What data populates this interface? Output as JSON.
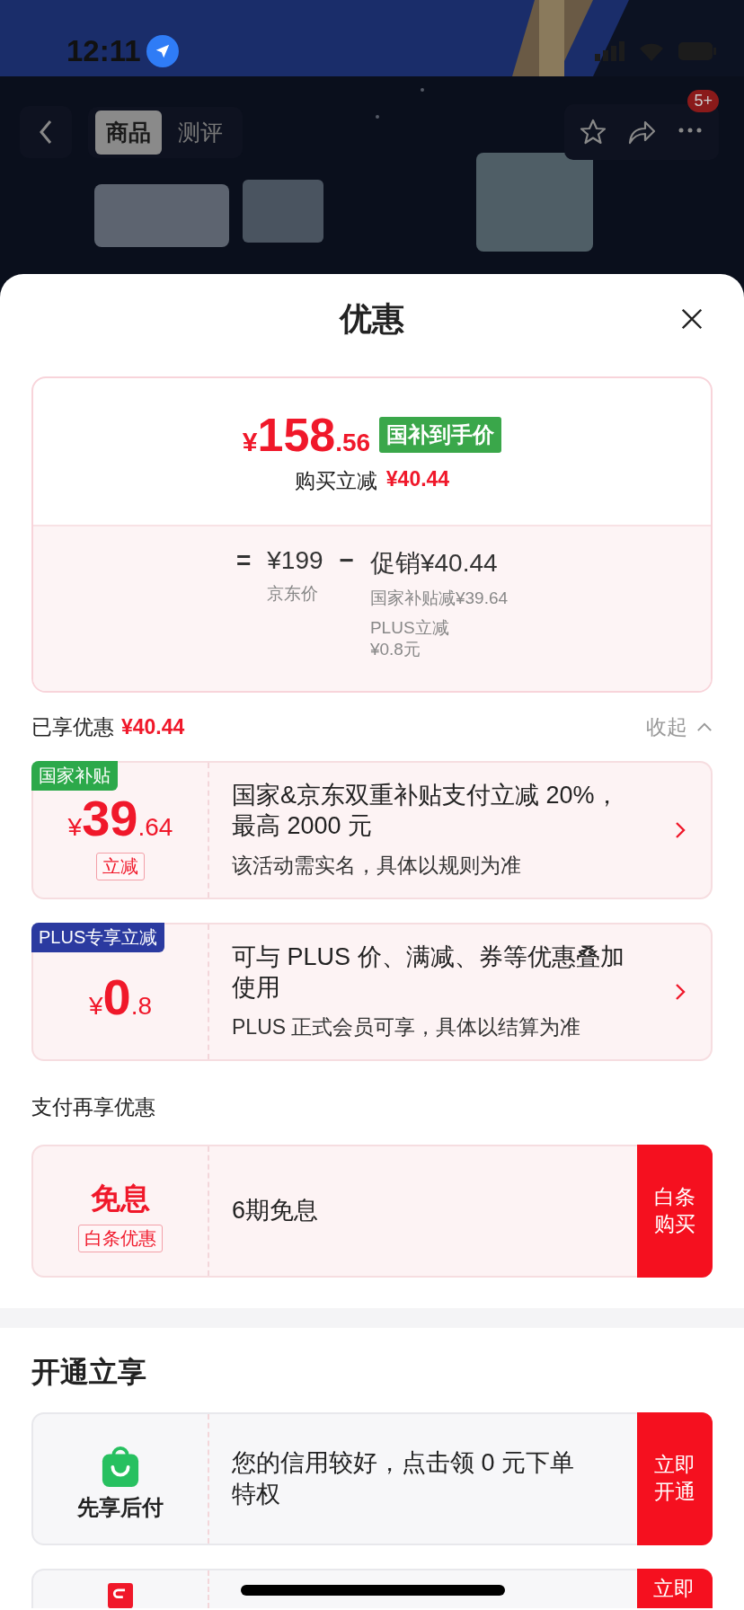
{
  "status_bar": {
    "time": "12:11"
  },
  "nav": {
    "tabs": [
      {
        "label": "商品",
        "selected": true
      },
      {
        "label": "测评",
        "selected": false
      }
    ],
    "more_badge": "5+"
  },
  "sheet": {
    "title": "优惠",
    "price_card": {
      "symbol": "¥",
      "price_int": "158",
      "price_dec": ".56",
      "price_tag": "国补到手价",
      "saving_label": "购买立减",
      "saving_value": "¥40.44",
      "equals": "=",
      "base_price": "¥199",
      "base_label": "京东价",
      "minus": "−",
      "promo": "促销¥40.44",
      "promo_details": [
        {
          "label": "国家补贴减",
          "value": "¥39.64",
          "stacked": false
        },
        {
          "label": "PLUS立减",
          "value": "¥0.8元",
          "stacked": true
        }
      ]
    },
    "applied": {
      "label": "已享优惠",
      "value": "¥40.44",
      "toggle": "收起",
      "expanded": true
    },
    "coupons": [
      {
        "tag": "国家补贴",
        "color": "#2ca94a",
        "symbol": "¥",
        "amount_int": "39",
        "amount_dec": ".64",
        "badge": "立减",
        "title": "国家&京东双重补贴支付立减 20%，最高 2000 元",
        "note": "该活动需实名，具体以规则为准"
      },
      {
        "tag": "PLUS专享立减",
        "color": "#2b3aa0",
        "symbol": "¥",
        "amount_int": "0",
        "amount_dec": ".8",
        "title": "可与 PLUS 价、满减、券等优惠叠加使用",
        "note": "PLUS 正式会员可享，具体以结算为准"
      }
    ],
    "payment": {
      "heading": "支付再享优惠",
      "offers": [
        {
          "kind": "text",
          "headline": "免息",
          "badge": "白条优惠",
          "title": "6期免息",
          "action": "白条购买"
        }
      ]
    },
    "open": {
      "heading": "开通立享",
      "offers": [
        {
          "kind": "bag",
          "label": "先享后付",
          "title": "您的信用较好，点击领 0 元下单特权",
          "action": "立即开通"
        },
        {
          "kind": "logo",
          "action": "立即"
        }
      ]
    }
  }
}
